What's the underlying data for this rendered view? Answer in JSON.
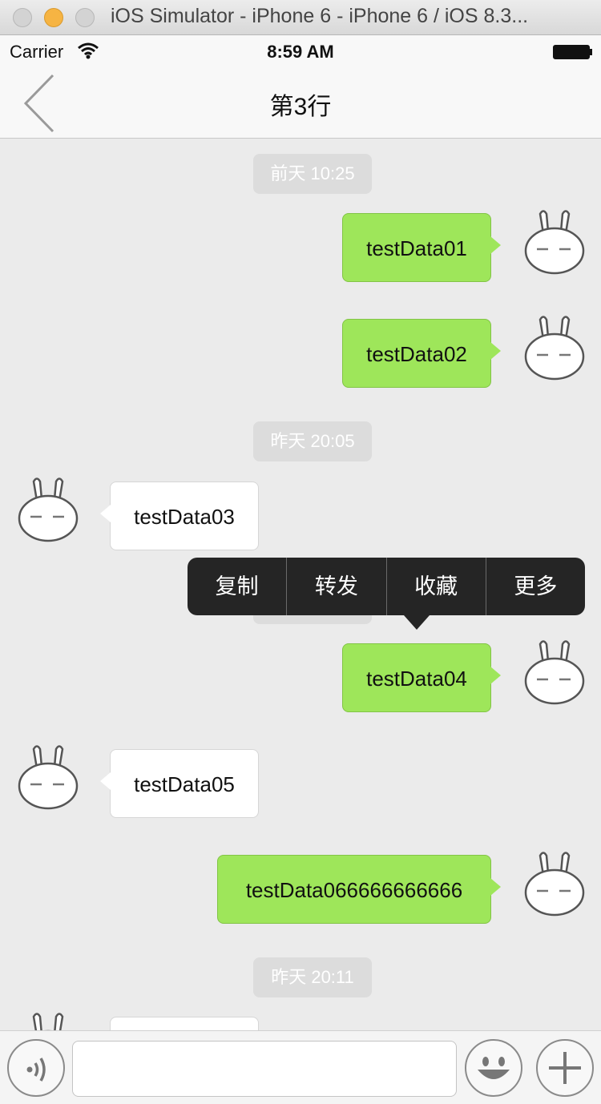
{
  "window": {
    "title": "iOS Simulator - iPhone 6 - iPhone 6 / iOS 8.3..."
  },
  "statusbar": {
    "carrier": "Carrier",
    "time": "8:59 AM"
  },
  "navbar": {
    "title": "第3行",
    "back_icon": "chevron-left-icon"
  },
  "chat": {
    "timestamps": [
      "前天 10:25",
      "昨天 20:05",
      "昨天 20:11"
    ],
    "messages": [
      {
        "text": "testData01",
        "sender": "me"
      },
      {
        "text": "testData02",
        "sender": "me"
      },
      {
        "text": "testData03",
        "sender": "other"
      },
      {
        "text": "testData04",
        "sender": "me"
      },
      {
        "text": "testData05",
        "sender": "other"
      },
      {
        "text": "testData066666666666",
        "sender": "me"
      }
    ]
  },
  "context_menu": {
    "items": [
      "复制",
      "转发",
      "收藏",
      "更多"
    ]
  },
  "input_bar": {
    "voice_icon": "voice-icon",
    "emoji_icon": "emoji-icon",
    "plus_icon": "plus-icon",
    "text_value": ""
  },
  "colors": {
    "outgoing_bubble": "#9ee65a",
    "incoming_bubble": "#ffffff",
    "background": "#ebebeb",
    "menu": "#252525"
  }
}
